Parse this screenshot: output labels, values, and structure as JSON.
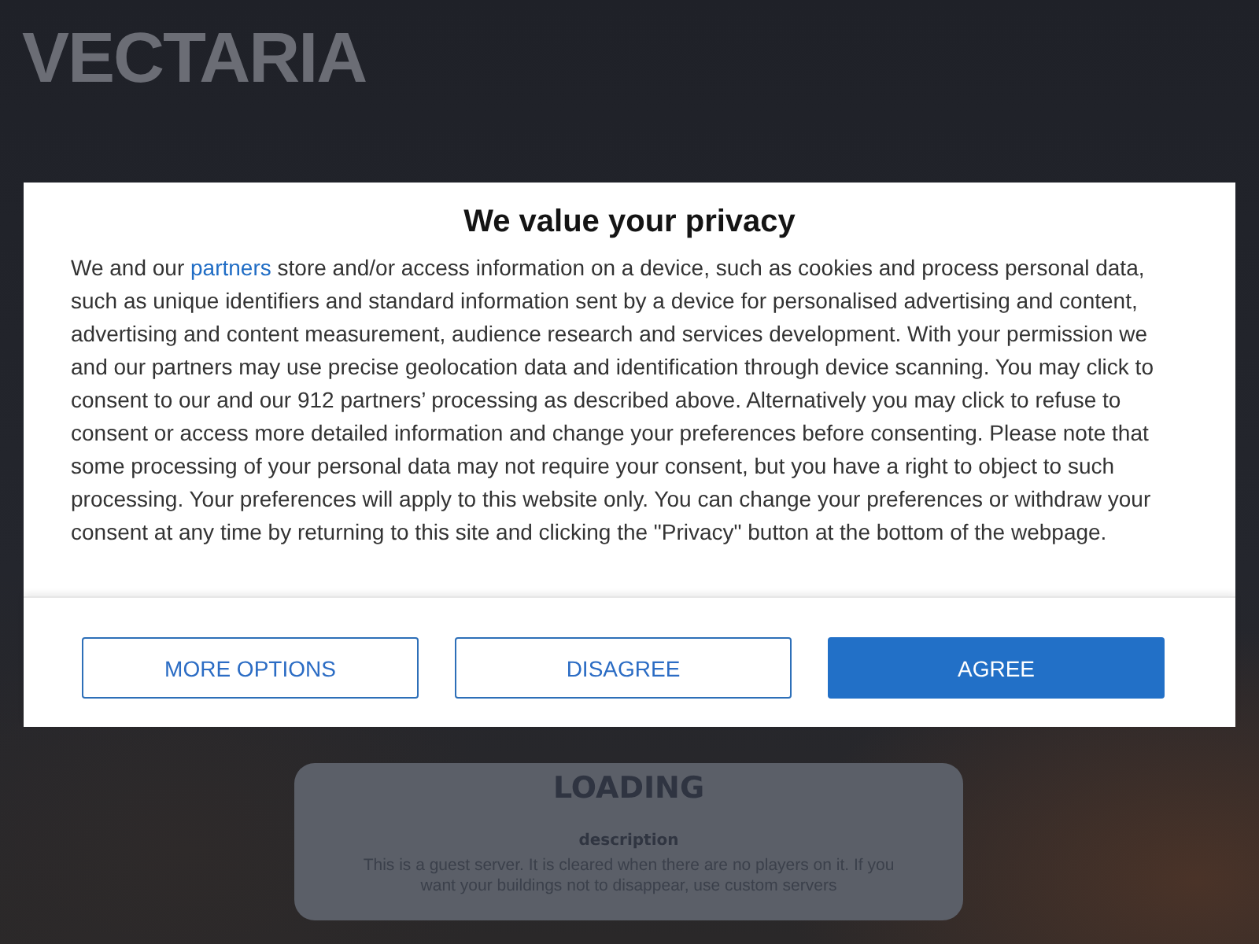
{
  "backdrop": {
    "logo": "VECTARIA",
    "loading_card": {
      "title": "LOADING",
      "heading": "description",
      "text": "This is a guest server. It is cleared when there are no players on it. If you want your buildings not to disappear, use custom servers"
    }
  },
  "dialog": {
    "title": "We value your privacy",
    "body": {
      "before": "We and our ",
      "link": "partners",
      "after": " store and/or access information on a device, such as cookies and process personal data, such as unique identifiers and standard information sent by a device for personalised advertising and content, advertising and content measurement, audience research and services development. With your permission we and our partners may use precise geolocation data and identification through device scanning. You may click to consent to our and our 912 partners’ processing as described above. Alternatively you may click to refuse to consent or access more detailed information and change your preferences before consenting. Please note that some processing of your personal data may not require your consent, but you have a right to object to such processing. Your preferences will apply to this website only. You can change your preferences or withdraw your consent at any time by returning to this site and clicking the \"Privacy\" button at the bottom of the webpage."
    },
    "buttons": [
      {
        "label": "MORE OPTIONS",
        "kind": "outline"
      },
      {
        "label": "DISAGREE",
        "kind": "outline"
      },
      {
        "label": "AGREE",
        "kind": "primary"
      }
    ]
  }
}
